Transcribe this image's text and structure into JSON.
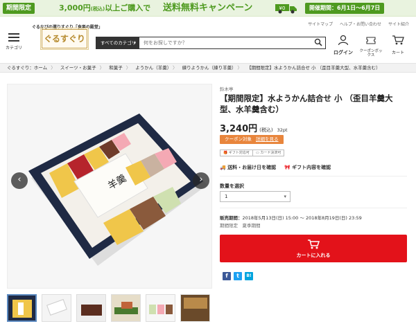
{
  "promo": {
    "tag": "期間限定",
    "lead": "3,000円",
    "lead_tax": "(税込)",
    "lead_rest": "以上ご購入で",
    "big": "送料無料キャンペーン",
    "truck_price": "¥0",
    "period": "開催期間：6月1日〜6月7日",
    "colors": {
      "accent": "#4e9a1f",
      "background": "#e9f3df"
    }
  },
  "util_links": [
    "サイトマップ",
    "ヘルプ・お問い合わせ",
    "サイト紹介"
  ],
  "header": {
    "menu_label": "カテゴリ",
    "tagline": "ぐるなびの選りすぐり「食楽の殿堂」",
    "logo_text": "ぐるすぐり",
    "search": {
      "category_label": "すべてのカテゴリ",
      "placeholder": "何をお探しですか？"
    },
    "login_label": "ログイン",
    "coupon_label": "クーポンボックス",
    "cart_label": "カート"
  },
  "breadcrumb": [
    "ぐるすぐり：ホーム",
    "スイーツ・お菓子",
    "和菓子",
    "ようかん（羊羹）",
    "練りようかん（練り羊羹）",
    "【期間限定】水ようかん詰合せ 小 （歪目羊羹大型、水羊羹含む）"
  ],
  "gallery": {
    "thumb_count": 6,
    "active_thumb": 0
  },
  "product": {
    "shop": "鈴木亭",
    "title": "【期間限定】水ようかん詰合せ 小 （歪目羊羹大型、水羊羹含む）",
    "price": "3,240円",
    "tax_note": "(税込)",
    "points": "32pt",
    "coupon_label": "クーポン対象",
    "coupon_link": "詳細を見る",
    "badges": [
      "ギフト対応可",
      "カード決済可"
    ],
    "shipping_link": "送料・お届け日を確認",
    "gift_link": "ギフト内容を確認",
    "qty_label": "数量を選択",
    "qty_value": "1",
    "sale_label": "販売期間：",
    "sale_period": "2018年5月13日(日) 15:00 〜 2018年8月19日(日) 23:59",
    "sale_tags": "期間限定　夏季期間",
    "cart_button": "カートに入れる",
    "cart_color": "#e3121a"
  },
  "social": [
    {
      "icon": "facebook-icon",
      "letter": "f",
      "color": "#3b5998"
    },
    {
      "icon": "twitter-icon",
      "letter": "t",
      "color": "#1da1f2"
    },
    {
      "icon": "hatena-icon",
      "letter": "B!",
      "color": "#00a4de"
    }
  ]
}
